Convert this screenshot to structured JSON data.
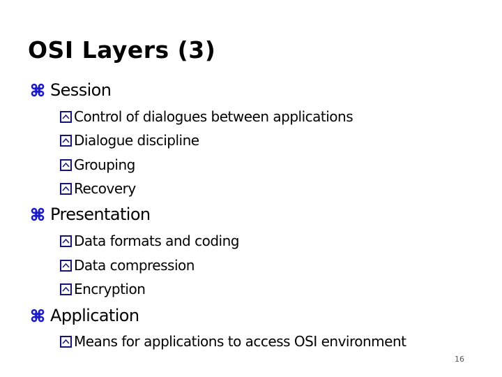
{
  "slide": {
    "title": "OSI Layers (3)",
    "page_number": "16",
    "colors": {
      "level1_bullet": "#1a1acc",
      "level2_bullet": "#14147a",
      "text": "#000000"
    },
    "bullet_icons": {
      "level1": "command-key-icon",
      "level2": "boxed-caret-icon"
    },
    "sections": [
      {
        "label": "Session",
        "items": [
          "Control of dialogues between applications",
          "Dialogue discipline",
          "Grouping",
          "Recovery"
        ]
      },
      {
        "label": "Presentation",
        "items": [
          "Data formats and coding",
          "Data compression",
          "Encryption"
        ]
      },
      {
        "label": "Application",
        "items": [
          "Means for applications to access OSI environment"
        ]
      }
    ]
  }
}
